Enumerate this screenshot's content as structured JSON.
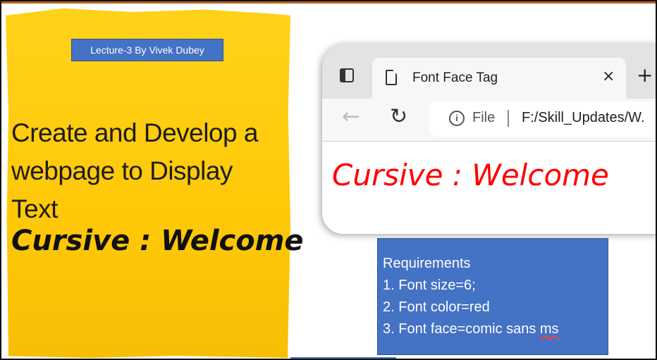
{
  "slide": {
    "badge": "Lecture-3 By Vivek Dubey",
    "heading_lines": [
      "Create and Develop a",
      "webpage to Display",
      "Text"
    ],
    "heading_cursive": "Cursive : Welcome"
  },
  "browser": {
    "tab_title": "Font Face Tag",
    "tab_close": "×",
    "new_tab": "+",
    "back": "←",
    "refresh": "↻",
    "info": "i",
    "file_label": "File",
    "url": "F:/Skill_Updates/W.",
    "page_text": "Cursive : Welcome",
    "page_text_color": "#ff0000"
  },
  "requirements": {
    "title": "Requirements",
    "items": [
      "1. Font size=6;",
      "2. Font color=red",
      "3. Font face=comic sans "
    ],
    "item3_underlined": "ms"
  },
  "colors": {
    "sticky": "#ffc807",
    "badge": "#4472c4",
    "req_box": "#4472c4"
  }
}
